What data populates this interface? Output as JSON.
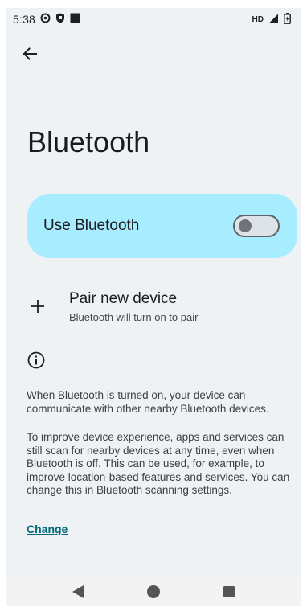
{
  "status_bar": {
    "time": "5:38",
    "network_label": "HD"
  },
  "page": {
    "title": "Bluetooth"
  },
  "toggle": {
    "label": "Use Bluetooth",
    "state": "off"
  },
  "pair": {
    "title": "Pair new device",
    "subtitle": "Bluetooth will turn on to pair"
  },
  "info": {
    "paragraph_1": "When Bluetooth is turned on, your device can communicate with other nearby Bluetooth devices.",
    "paragraph_2": "To improve device experience, apps and services can still scan for nearby devices at any time, even when Bluetooth is off. This can be used, for example, to improve location-based features and services. You can change this in Bluetooth scanning settings.",
    "link": "Change"
  },
  "colors": {
    "toggle_card_bg": "#a8edff",
    "link": "#006878",
    "screen_bg": "#eef2f5"
  },
  "icons": [
    "back-arrow-icon",
    "plus-icon",
    "info-icon",
    "nav-back-icon",
    "nav-home-icon",
    "nav-recents-icon"
  ]
}
